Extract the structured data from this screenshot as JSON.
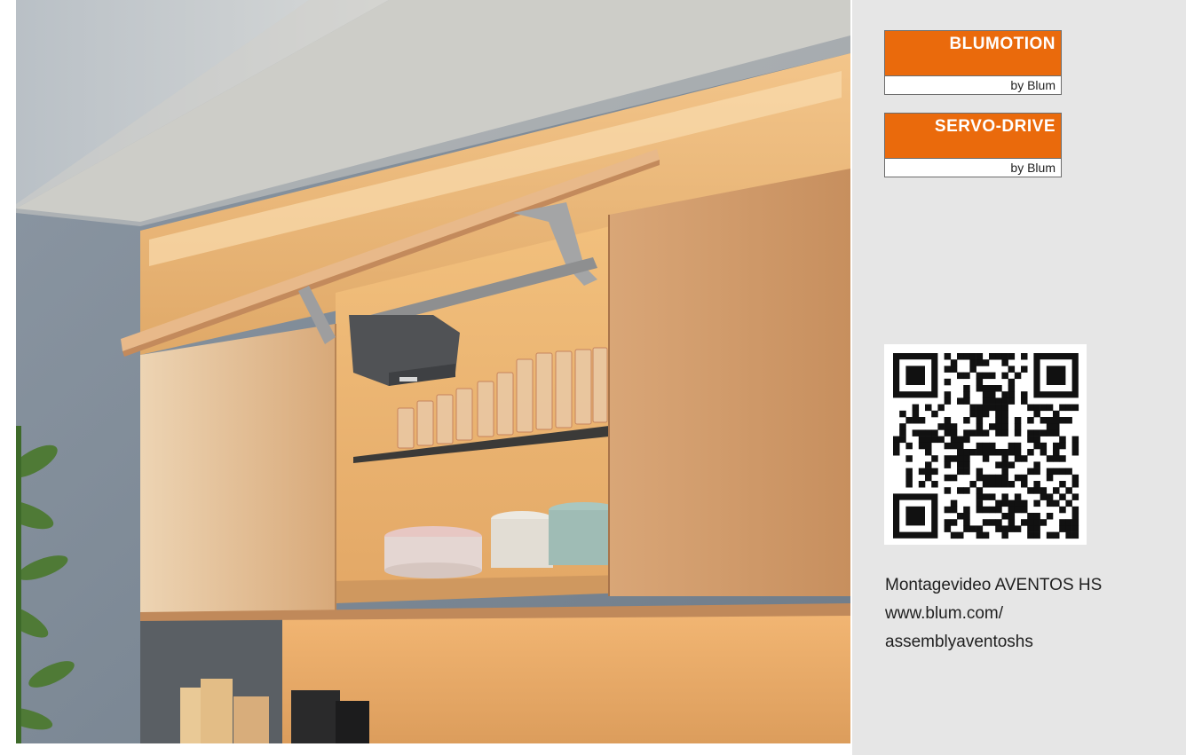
{
  "photo": {
    "description_icon": "kitchen-cabinet-photo"
  },
  "badges": [
    {
      "brand": "BLUMOTION",
      "byline": "by Blum"
    },
    {
      "brand": "SERVO-DRIVE",
      "byline": "by Blum"
    }
  ],
  "qr": {
    "icon": "qr-code-icon"
  },
  "info": {
    "line1": "Montagevideo AVENTOS HS",
    "line2": "www.blum.com/",
    "line3": "assemblyaventoshs"
  },
  "colors": {
    "brand_orange": "#ea6a0c",
    "panel_bg": "#e6e6e6",
    "wood": "#d9a878"
  }
}
